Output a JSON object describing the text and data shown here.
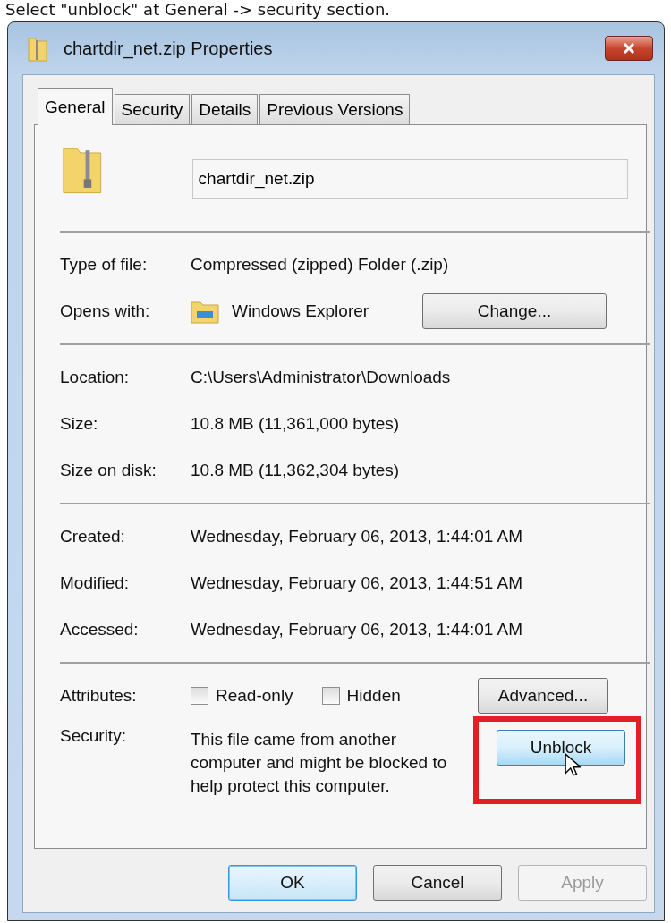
{
  "caption": "Select \"unblock\" at General -> security section.",
  "window": {
    "title": "chartdir_net.zip Properties"
  },
  "tabs": [
    {
      "label": "General",
      "selected": true
    },
    {
      "label": "Security",
      "selected": false
    },
    {
      "label": "Details",
      "selected": false
    },
    {
      "label": "Previous Versions",
      "selected": false
    }
  ],
  "file_name": "chartdir_net.zip",
  "type_of_file": {
    "label": "Type of file:",
    "value": "Compressed (zipped) Folder (.zip)"
  },
  "opens_with": {
    "label": "Opens with:",
    "value": "Windows Explorer",
    "button": "Change..."
  },
  "location_group": [
    {
      "label": "Location:",
      "value": "C:\\Users\\Administrator\\Downloads"
    },
    {
      "label": "Size:",
      "value": "10.8 MB (11,361,000 bytes)"
    },
    {
      "label": "Size on disk:",
      "value": "10.8 MB (11,362,304 bytes)"
    }
  ],
  "date_group": [
    {
      "label": "Created:",
      "value": "Wednesday, February 06, 2013, 1:44:01 AM"
    },
    {
      "label": "Modified:",
      "value": "Wednesday, February 06, 2013, 1:44:51 AM"
    },
    {
      "label": "Accessed:",
      "value": "Wednesday, February 06, 2013, 1:44:01 AM"
    }
  ],
  "attributes": {
    "label": "Attributes:",
    "checkboxes": [
      {
        "label": "Read-only",
        "checked": false
      },
      {
        "label": "Hidden",
        "checked": false
      }
    ],
    "button": "Advanced..."
  },
  "security": {
    "label": "Security:",
    "text": "This file came from another computer and might be blocked to help protect this computer.",
    "button": "Unblock",
    "highlighted": true
  },
  "buttons": [
    {
      "label": "OK",
      "kind": "default",
      "disabled": false
    },
    {
      "label": "Cancel",
      "kind": "normal",
      "disabled": false
    },
    {
      "label": "Apply",
      "kind": "normal",
      "disabled": true
    }
  ]
}
